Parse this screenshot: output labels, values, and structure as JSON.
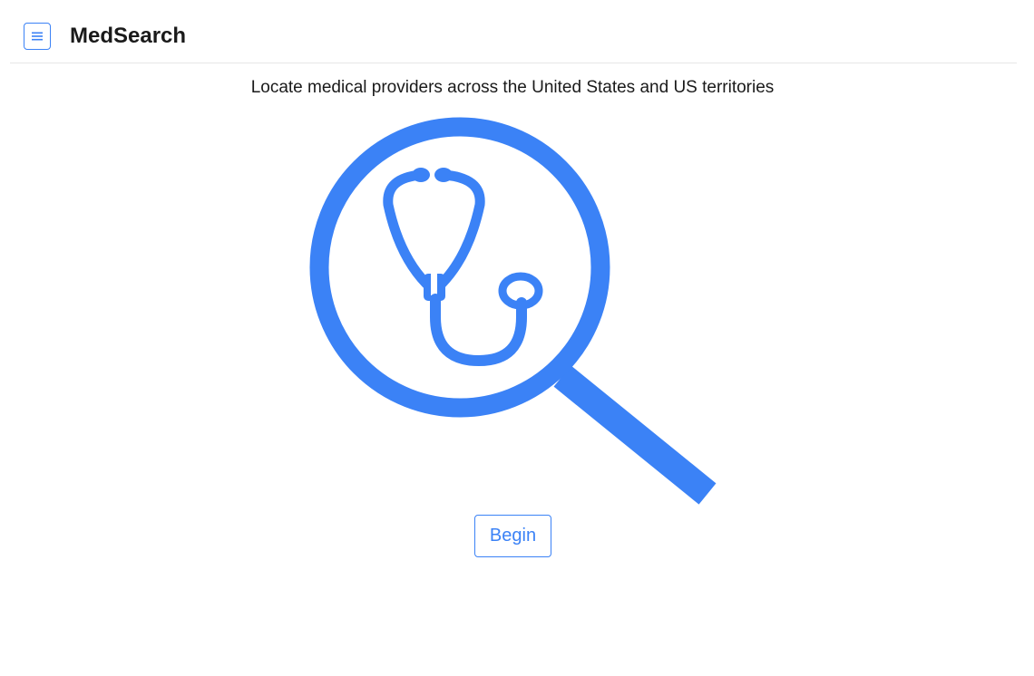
{
  "header": {
    "menu_icon": "hamburger-icon",
    "title": "MedSearch"
  },
  "main": {
    "tagline": "Locate medical providers across the United States and US territories",
    "hero_icon": "stethoscope-magnifier-icon",
    "begin_label": "Begin"
  },
  "colors": {
    "accent": "#3b82f6",
    "text": "#1a1a1a",
    "divider": "#e6e6e6"
  }
}
